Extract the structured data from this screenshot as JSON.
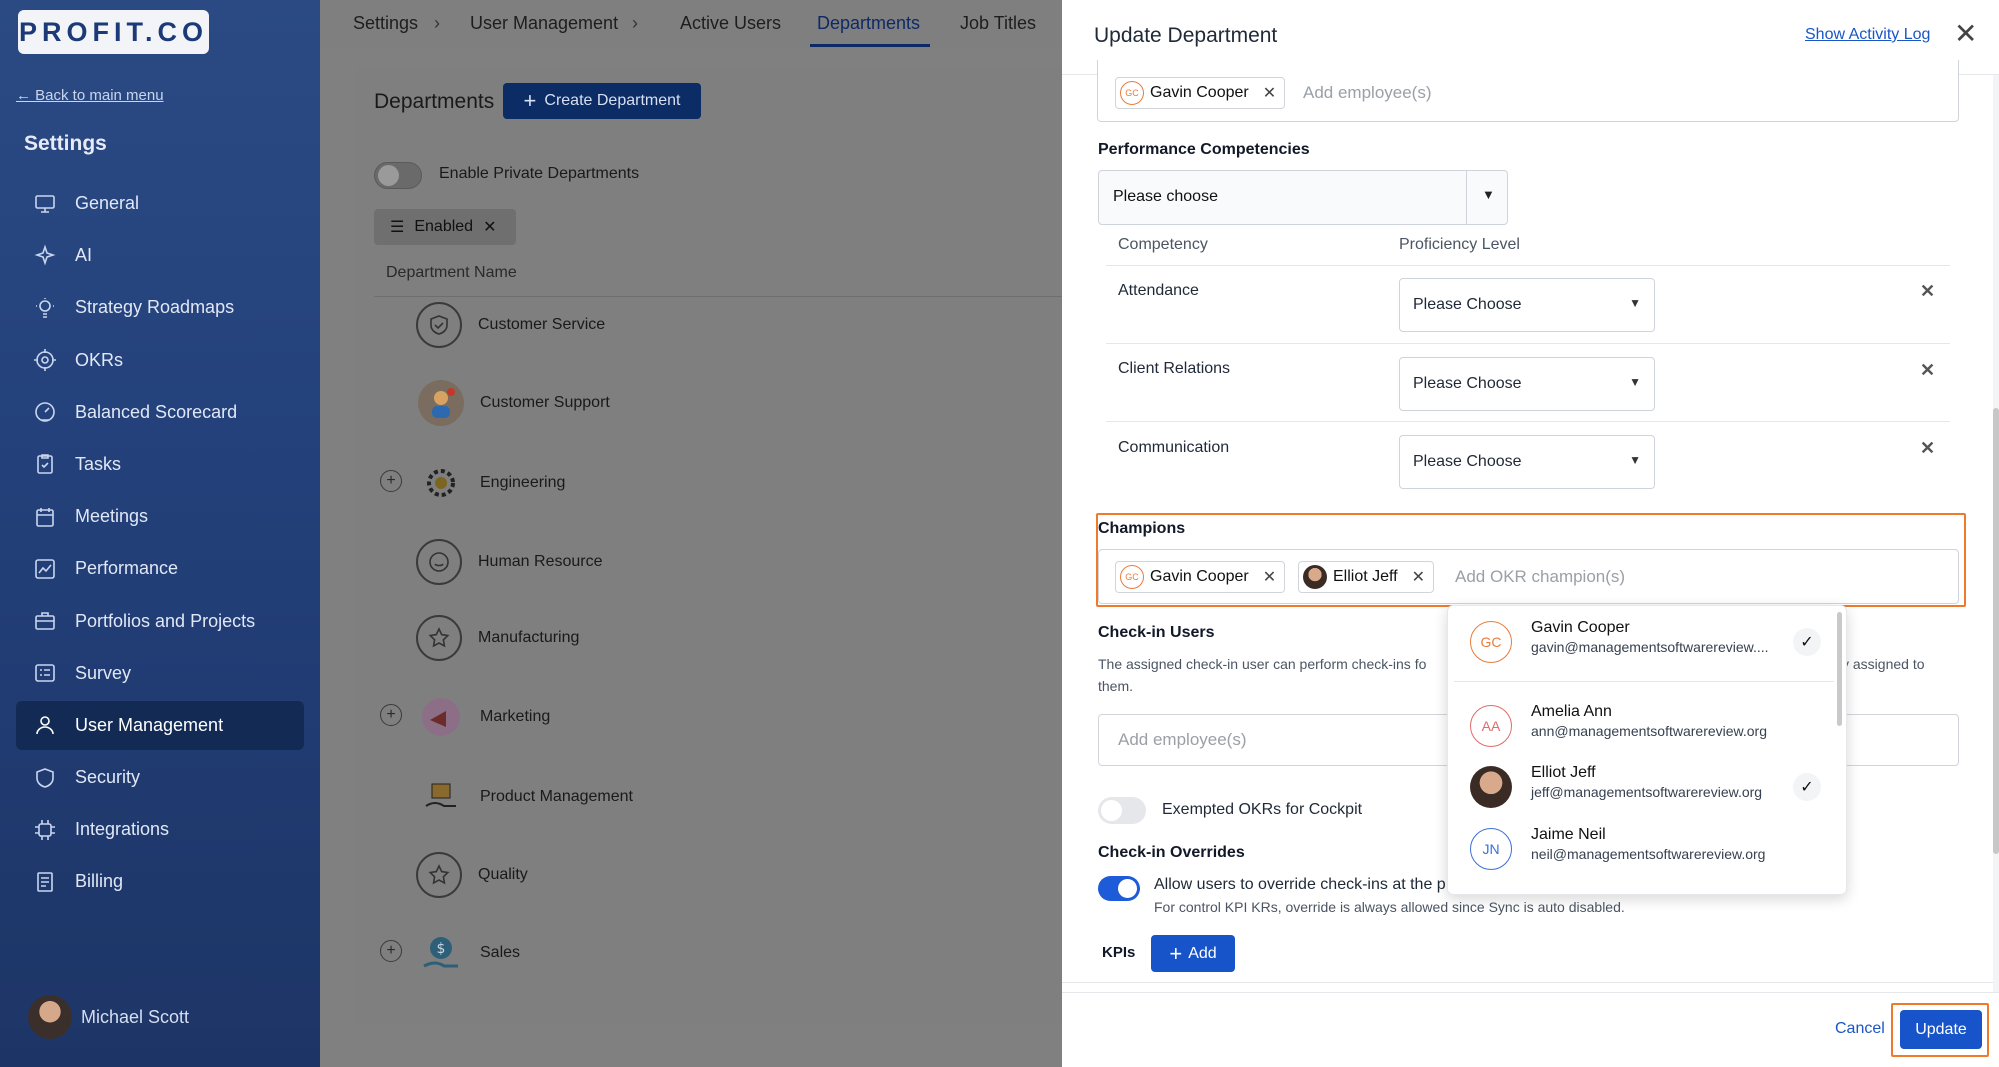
{
  "sidebar": {
    "logo": "PROFIT.CO",
    "back_link": "← Back to main menu",
    "heading": "Settings",
    "items": [
      {
        "label": "General",
        "icon": "monitor-icon"
      },
      {
        "label": "AI",
        "icon": "sparkle-icon"
      },
      {
        "label": "Strategy Roadmaps",
        "icon": "lightbulb-icon"
      },
      {
        "label": "OKRs",
        "icon": "target-icon"
      },
      {
        "label": "Balanced Scorecard",
        "icon": "gauge-icon"
      },
      {
        "label": "Tasks",
        "icon": "clipboard-check-icon"
      },
      {
        "label": "Meetings",
        "icon": "calendar-icon"
      },
      {
        "label": "Performance",
        "icon": "chart-icon"
      },
      {
        "label": "Portfolios and Projects",
        "icon": "briefcase-icon"
      },
      {
        "label": "Survey",
        "icon": "survey-icon"
      },
      {
        "label": "User Management",
        "icon": "user-icon",
        "active": true
      },
      {
        "label": "Security",
        "icon": "shield-icon"
      },
      {
        "label": "Integrations",
        "icon": "chip-icon"
      },
      {
        "label": "Billing",
        "icon": "receipt-icon"
      }
    ],
    "user_name": "Michael Scott"
  },
  "topbar": {
    "crumb_settings": "Settings",
    "crumb_user_mgmt": "User Management",
    "tab_active_users": "Active Users",
    "tab_departments": "Departments",
    "tab_job_titles": "Job Titles",
    "separator": "›"
  },
  "departments": {
    "title": "Departments",
    "create_label": "Create Department",
    "private_label": "Enable Private Departments",
    "filter_label": "Enabled",
    "column_header": "Department Name",
    "rows": [
      {
        "name": "Customer Service",
        "icon": "shield-check-icon"
      },
      {
        "name": "Customer Support",
        "icon": "support-agent-icon"
      },
      {
        "name": "Engineering",
        "icon": "gear-icon"
      },
      {
        "name": "Human Resource",
        "icon": "smiley-icon"
      },
      {
        "name": "Manufacturing",
        "icon": "star-icon"
      },
      {
        "name": "Marketing",
        "icon": "megaphone-icon"
      },
      {
        "name": "Product Management",
        "icon": "box-hand-icon"
      },
      {
        "name": "Quality",
        "icon": "star-icon"
      },
      {
        "name": "Sales",
        "icon": "dollar-hand-icon"
      }
    ]
  },
  "panel": {
    "title": "Update Department",
    "activity_link": "Show Activity Log",
    "top_chip": "Gavin Cooper",
    "top_placeholder": "Add employee(s)",
    "competencies_label": "Performance Competencies",
    "competencies_select": "Please choose",
    "col_competency": "Competency",
    "col_proficiency": "Proficiency Level",
    "competencies": [
      {
        "name": "Attendance",
        "level": "Please Choose"
      },
      {
        "name": "Client Relations",
        "level": "Please Choose"
      },
      {
        "name": "Communication",
        "level": "Please Choose"
      }
    ],
    "champions_label": "Champions",
    "champion_chips": [
      "Gavin Cooper",
      "Elliot Jeff"
    ],
    "champions_placeholder": "Add OKR champion(s)",
    "checkin_label": "Check-in Users",
    "checkin_desc_left": "The assigned check-in user can perform check-ins fo",
    "checkin_desc_right": "y assigned to",
    "checkin_desc_cont": "them.",
    "checkin_placeholder": "Add employee(s)",
    "exempt_label": "Exempted OKRs for Cockpit",
    "overrides_label": "Check-in Overrides",
    "override_text": "Allow users to override check-ins at the p",
    "override_note": "For control KPI KRs, override is always allowed since Sync is auto disabled.",
    "kpis_label": "KPIs",
    "add_label": "Add",
    "cancel_label": "Cancel",
    "update_label": "Update"
  },
  "dropdown": [
    {
      "initials": "GC",
      "name": "Gavin Cooper",
      "email": "gavin@managementsoftwarereview....",
      "checked": true
    },
    {
      "initials": "AA",
      "name": "Amelia Ann",
      "email": "ann@managementsoftwarereview.org",
      "checked": false
    },
    {
      "initials": "",
      "name": "Elliot Jeff",
      "email": "jeff@managementsoftwarereview.org",
      "checked": true
    },
    {
      "initials": "JN",
      "name": "Jaime Neil",
      "email": "neil@managementsoftwarereview.org",
      "checked": false
    }
  ],
  "colors": {
    "sidebar_bg": "#23407a",
    "accent_blue": "#1753c9",
    "highlight_orange": "#f07a2c"
  }
}
